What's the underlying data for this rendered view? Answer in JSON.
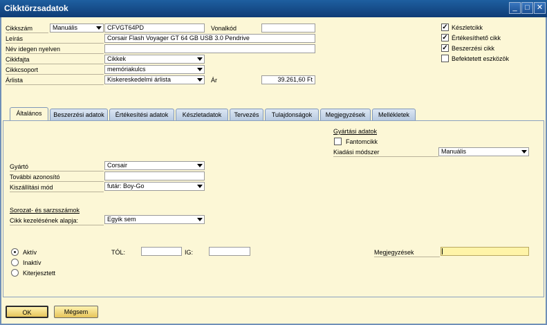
{
  "window": {
    "title": "Cikktörzsadatok",
    "controls": [
      "_",
      "□",
      "✕"
    ]
  },
  "header": {
    "item_no": {
      "label": "Cikkszám",
      "series": "Manuális",
      "value": "CFVGT64PD"
    },
    "barcode": {
      "label": "Vonalkód",
      "value": ""
    },
    "description": {
      "label": "Leírás",
      "value": "Corsair Flash Voyager GT 64 GB USB 3.0 Pendrive"
    },
    "foreign_name": {
      "label": "Név idegen nyelven",
      "value": ""
    },
    "item_type": {
      "label": "Cikkfajta",
      "value": "Cikkek"
    },
    "item_group": {
      "label": "Cikkcsoport",
      "value": "memóriakulcs"
    },
    "price_list": {
      "label": "Árlista",
      "value": "Kiskereskedelmi árlista"
    },
    "price": {
      "label": "Ár",
      "value": "39.261,60 Ft"
    },
    "checks": [
      {
        "label": "Készletcikk",
        "checked": true
      },
      {
        "label": "Értékesíthető cikk",
        "checked": true
      },
      {
        "label": "Beszerzési cikk",
        "checked": true
      },
      {
        "label": "Befektetett eszközök",
        "checked": false
      }
    ]
  },
  "tabs": [
    {
      "label": "Általános",
      "active": true
    },
    {
      "label": "Beszerzési adatok",
      "active": false
    },
    {
      "label": "Értékesítési adatok",
      "active": false
    },
    {
      "label": "Készletadatok",
      "active": false
    },
    {
      "label": "Tervezés",
      "active": false
    },
    {
      "label": "Tulajdonságok",
      "active": false
    },
    {
      "label": "Megjegyzések",
      "active": false
    },
    {
      "label": "Mellékletek",
      "active": false
    }
  ],
  "general": {
    "production": {
      "title": "Gyártási adatok",
      "phantom": {
        "label": "Fantomcikk",
        "checked": false
      },
      "issue_method": {
        "label": "Kiadási módszer",
        "value": "Manuális"
      }
    },
    "manufacturer": {
      "label": "Gyártó",
      "value": "Corsair"
    },
    "additional_id": {
      "label": "További azonosító",
      "value": ""
    },
    "shipping_type": {
      "label": "Kiszállítási mód",
      "value": "futár: Boy-Go"
    },
    "serials": {
      "title": "Sorozat- és sarzsszámok",
      "management": {
        "label": "Cikk kezelésének alapja:",
        "value": "Egyik sem"
      }
    },
    "status": [
      {
        "label": "Aktív",
        "selected": true
      },
      {
        "label": "Inaktív",
        "selected": false
      },
      {
        "label": "Kiterjesztett",
        "selected": false
      }
    ],
    "from": {
      "label": "TÓL:",
      "value": ""
    },
    "to": {
      "label": "IG:",
      "value": ""
    },
    "remarks": {
      "label": "Megjegyzések",
      "value": ""
    }
  },
  "buttons": {
    "ok": "OK",
    "cancel": "Mégsem"
  },
  "colors": {
    "titlebar": "#1e5fa0",
    "background": "#fcf7d6",
    "button": "#e6c45a",
    "highlight_field": "#fff4a8"
  }
}
